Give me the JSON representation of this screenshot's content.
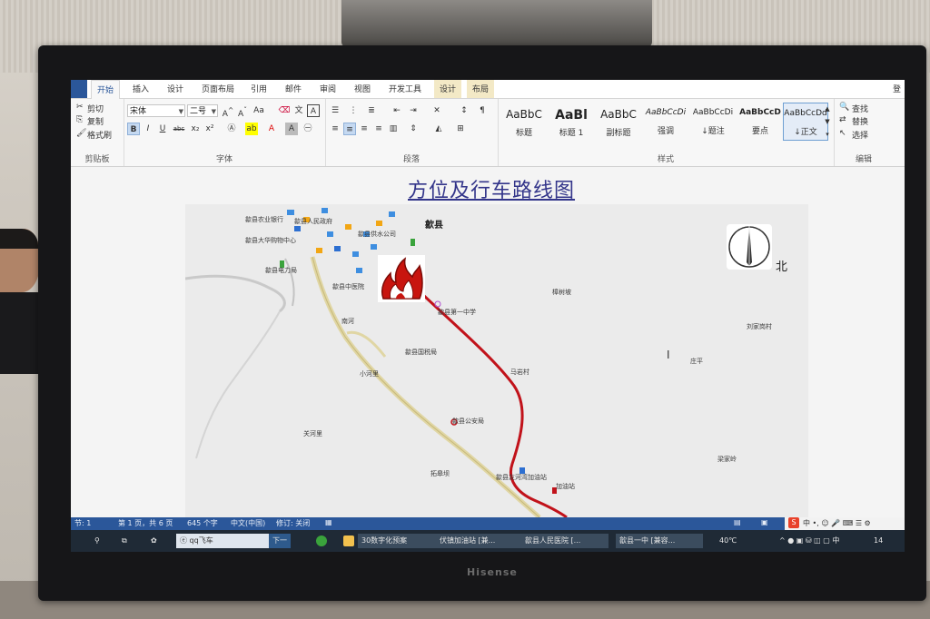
{
  "ribbon": {
    "tabs": [
      "开始",
      "插入",
      "设计",
      "页面布局",
      "引用",
      "邮件",
      "审阅",
      "视图",
      "开发工具",
      "设计",
      "布局"
    ],
    "login": "登",
    "clipboard": {
      "cut": "剪切",
      "copy": "复制",
      "format_painter": "格式刷",
      "label": "剪贴板"
    },
    "font": {
      "name": "宋体",
      "size": "二号",
      "label": "字体"
    },
    "paragraph": {
      "label": "段落"
    },
    "styles": {
      "items": [
        {
          "sample": "AaBbC",
          "name": "标题"
        },
        {
          "sample": "AaBl",
          "name": "标题 1"
        },
        {
          "sample": "AaBbC",
          "name": "副标题"
        },
        {
          "sample": "AaBbCcDi",
          "name": "强调"
        },
        {
          "sample": "AaBbCcDi",
          "name": "↓题注"
        },
        {
          "sample": "AaBbCcD",
          "name": "要点"
        },
        {
          "sample": "AaBbCcDd",
          "name": "↓正文"
        }
      ],
      "label": "样式"
    },
    "editing": {
      "find": "查找",
      "replace": "替换",
      "select": "选择",
      "label": "编辑"
    }
  },
  "document": {
    "title": "方位及行车路线图",
    "map": {
      "labels": [
        {
          "text": "歙县农业银行"
        },
        {
          "text": "歙县人民政府"
        },
        {
          "text": "歙县"
        },
        {
          "text": "歙县大华购物中心"
        },
        {
          "text": "歙县供水公司"
        },
        {
          "text": "歙县电力局"
        },
        {
          "text": "歙县中医院"
        },
        {
          "text": "歙县第一中学"
        },
        {
          "text": "樟树坡"
        },
        {
          "text": "南河"
        },
        {
          "text": "歙县国税局"
        },
        {
          "text": "小河里"
        },
        {
          "text": "马岩村"
        },
        {
          "text": "歙县公安局"
        },
        {
          "text": "关河里"
        },
        {
          "text": "拓皋坝"
        },
        {
          "text": "歙县友河湾加油站"
        },
        {
          "text": "加油站"
        },
        {
          "text": "刘家岗村"
        },
        {
          "text": "庄平"
        },
        {
          "text": "梁家岭"
        }
      ],
      "north_label": "北"
    }
  },
  "statusbar": {
    "section": "节: 1",
    "page": "第 1 页，共 6 页",
    "words": "645 个字",
    "lang": "中文(中国)",
    "track": "修订: 关闭"
  },
  "taskbar": {
    "search": "qq飞车",
    "next": "下一",
    "windows": [
      "30数字化预案",
      "伏镇加油站 [兼...",
      "歙县人民医院 [...",
      "歙县一中 [兼容..."
    ],
    "temp": "40℃",
    "clock": "14"
  },
  "monitor_brand": "Hisense"
}
